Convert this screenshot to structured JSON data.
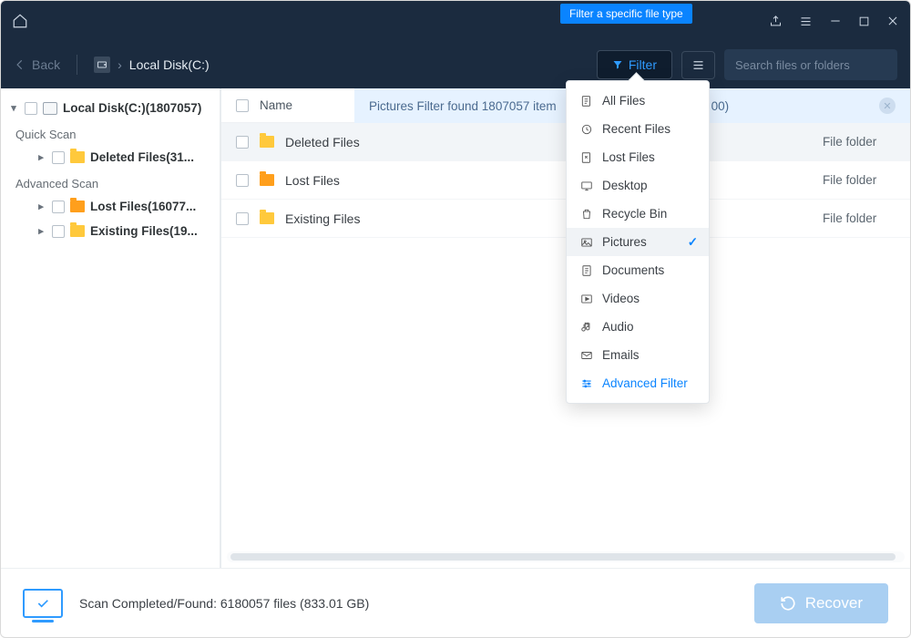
{
  "tooltip": "Filter a specific file type",
  "toolbar": {
    "back_label": "Back",
    "breadcrumb": "Local Disk(C:)",
    "filter_label": "Filter",
    "search_placeholder": "Search files or folders"
  },
  "sidebar": {
    "root_label": "Local Disk(C:)(1807057)",
    "groups": [
      {
        "label": "Quick Scan",
        "items": [
          {
            "label": "Deleted Files(31..."
          }
        ]
      },
      {
        "label": "Advanced Scan",
        "items": [
          {
            "label": "Lost Files(16077...",
            "orange": true
          },
          {
            "label": "Existing Files(19..."
          }
        ]
      }
    ]
  },
  "table": {
    "header_name": "Name",
    "banner": "Pictures Filter found 1807057 item",
    "banner_tail": "00)",
    "rows": [
      {
        "name": "Deleted Files",
        "type": "File folder",
        "selected": true
      },
      {
        "name": "Lost Files",
        "type": "File folder",
        "orange": true
      },
      {
        "name": "Existing Files",
        "type": "File folder"
      }
    ]
  },
  "dropdown": {
    "items": [
      {
        "label": "All Files",
        "icon": "all"
      },
      {
        "label": "Recent Files",
        "icon": "recent"
      },
      {
        "label": "Lost Files",
        "icon": "lost"
      },
      {
        "label": "Desktop",
        "icon": "desktop"
      },
      {
        "label": "Recycle Bin",
        "icon": "recycle"
      },
      {
        "label": "Pictures",
        "icon": "pictures",
        "selected": true
      },
      {
        "label": "Documents",
        "icon": "docs"
      },
      {
        "label": "Videos",
        "icon": "videos"
      },
      {
        "label": "Audio",
        "icon": "audio"
      },
      {
        "label": "Emails",
        "icon": "emails"
      }
    ],
    "advanced_label": "Advanced Filter"
  },
  "footer": {
    "status": "Scan Completed/Found: 6180057 files (833.01 GB)",
    "recover_label": "Recover"
  }
}
